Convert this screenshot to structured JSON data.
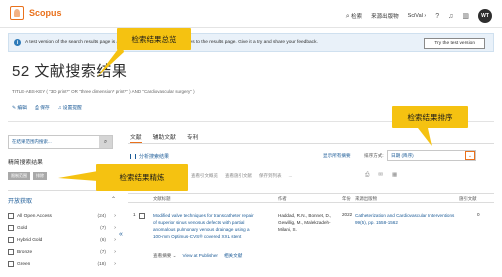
{
  "nav": {
    "brand": "Scopus",
    "search": "检索",
    "sources": "来源出版物",
    "scival": "SciVal ›",
    "help_icon": "?",
    "notifications_icon": "bell-icon",
    "library_icon": "library-icon",
    "avatar_initials": "WT"
  },
  "banner": {
    "text": "A test version of the search results page is available. We've added new features to the results page. Give it a try and share your feedback.",
    "button": "Try the test version"
  },
  "page": {
    "title": "52 文献搜索结果",
    "query": "TITLE-ABS-KEY ( \"3D print*\" OR \"three dimension* print*\" ) AND \"Cardiovascular surgery\" )",
    "actions": [
      "✎ 编辑",
      "⎙ 保存",
      "♫ 设置提醒"
    ]
  },
  "sidebar": {
    "search_within_placeholder": "在结果范围内搜索...",
    "refine_title": "精简搜索结果",
    "refine_buttons": [
      "限制范围",
      "排除"
    ],
    "oa_header": "开放获取",
    "oa_items": [
      {
        "label": "All Open Access",
        "count": "(24)"
      },
      {
        "label": "Gold",
        "count": "(7)"
      },
      {
        "label": "Hybrid Gold",
        "count": "(6)"
      },
      {
        "label": "Bronze",
        "count": "(7)"
      },
      {
        "label": "Green",
        "count": "(18)"
      }
    ]
  },
  "main": {
    "tabs": [
      "文献",
      "辅助文献",
      "专利"
    ],
    "analyze": "分析搜索结果",
    "show_abstract": "显示所有摘要",
    "sort_label": "排序方式:",
    "sort_value": "日期 (降序)",
    "toolbar": [
      "全部",
      "导出",
      "下载",
      "查看引文概览",
      "查看施引文献",
      "保存到列表",
      "..."
    ],
    "toolbar_icons": [
      "print-icon",
      "email-icon",
      "table-icon"
    ],
    "table_headers": {
      "title": "文献标题",
      "authors": "作者",
      "year": "年份",
      "source": "来源出版物",
      "cites": "施引文献"
    },
    "rows": [
      {
        "num": "1",
        "title": "Modified valve techniques for transcatheter repair of superior sinus venosus defects with partial anomalous pulmonary venous drainage using a 100-mm Optimus-CVS® covered XXL stent",
        "authors": "Haddad, R.N., Bonnet, D., Gewillig, M., Malekzadeh-Milani, S.",
        "year": "2022",
        "source": "Catheterization and Cardiovascular Interventions 99(5), pp. 1558-1562",
        "cites": "0"
      }
    ],
    "row_links": [
      "查看摘要 ⌄",
      "View at Publisher",
      "相关文献"
    ]
  },
  "annotations": {
    "overview": "检索结果总览",
    "sort": "检索结果排序",
    "refine": "检索结果精炼"
  }
}
